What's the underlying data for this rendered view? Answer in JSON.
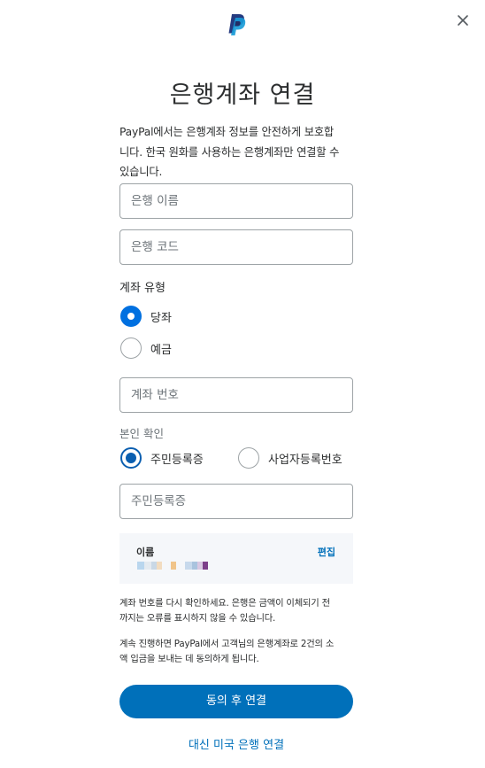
{
  "brand": {
    "logo_icon": "paypal-logo-icon",
    "dark": "#253b80",
    "light": "#179bd7"
  },
  "header": {
    "close_icon": "close-icon"
  },
  "page": {
    "title": "은행계좌 연결",
    "intro_line1": "PayPal에서는 은행계좌 정보를 안전하게 보호합",
    "intro_line2": "니다. 한국 원화를 사용하는 은행계좌만 연결할 수",
    "intro_line3": "있습니다."
  },
  "form": {
    "bank_name_placeholder": "은행 이름",
    "bank_code_placeholder": "은행 코드",
    "account_type_label": "계좌 유형",
    "account_types": [
      {
        "label": "당좌",
        "selected": true
      },
      {
        "label": "예금",
        "selected": false
      }
    ],
    "account_number_placeholder": "계좌 번호",
    "identity_label": "본인 확인",
    "identity_types": [
      {
        "label": "주민등록증",
        "selected": true
      },
      {
        "label": "사업자등록번호",
        "selected": false
      }
    ],
    "id_number_placeholder": "주민등록증"
  },
  "name_box": {
    "label": "이름",
    "edit_label": "편집"
  },
  "notes": {
    "note1_line1": "계좌 번호를 다시 확인하세요. 은행은 금액이 이체되기 전",
    "note1_line2": "까지는 오류를 표시하지 않을 수 있습니다.",
    "note2_line1": "계속 진행하면 PayPal에서 고객님의 은행계좌로 2건의 소",
    "note2_line2": "액 입금을 보내는 데 동의하게 됩니다."
  },
  "actions": {
    "primary_label": "동의 후 연결",
    "alt_link_label": "대신 미국 은행 연결"
  },
  "colors": {
    "accent": "#0070ba",
    "radio_selected": "#0070e0"
  }
}
